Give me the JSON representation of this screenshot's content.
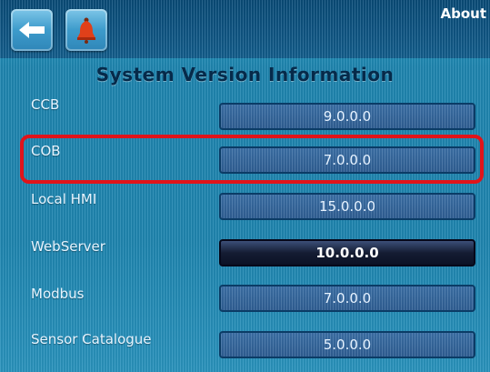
{
  "header": {
    "title": "About",
    "back_icon": "back-arrow-icon",
    "alarm_icon": "alarm-bell-icon"
  },
  "page": {
    "title": "System Version Information"
  },
  "rows": [
    {
      "label": "CCB",
      "value": "9.0.0.0"
    },
    {
      "label": "COB",
      "value": "7.0.0.0"
    },
    {
      "label": "Local HMI",
      "value": "15.0.0.0"
    },
    {
      "label": "WebServer",
      "value": "10.0.0.0"
    },
    {
      "label": "Modbus",
      "value": "7.0.0.0"
    },
    {
      "label": "Sensor Catalogue",
      "value": "5.0.0.0"
    }
  ],
  "colors": {
    "highlight_outline": "#e0141a",
    "selected_box": "#141c33"
  }
}
